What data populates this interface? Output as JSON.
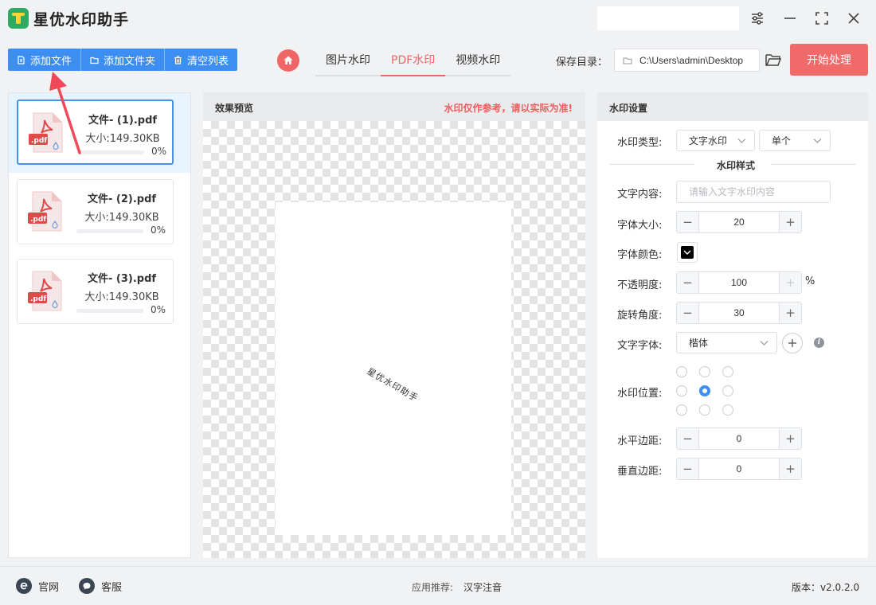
{
  "app": {
    "title": "星优水印助手"
  },
  "toolbar": {
    "add_file": "添加文件",
    "add_folder": "添加文件夹",
    "clear_list": "清空列表"
  },
  "tabs": [
    {
      "label": "图片水印",
      "active": false
    },
    {
      "label": "PDF水印",
      "active": true
    },
    {
      "label": "视频水印",
      "active": false
    }
  ],
  "save": {
    "label": "保存目录：",
    "path": "C:\\Users\\admin\\Desktop"
  },
  "start_button": "开始处理",
  "files": [
    {
      "name": "文件- (1).pdf",
      "size": "大小:149.30KB",
      "progress": "0%",
      "progress_value": 0,
      "selected": true
    },
    {
      "name": "文件- (2).pdf",
      "size": "大小:149.30KB",
      "progress": "0%",
      "progress_value": 0,
      "selected": false
    },
    {
      "name": "文件- (3).pdf",
      "size": "大小:149.30KB",
      "progress": "0%",
      "progress_value": 0,
      "selected": false
    }
  ],
  "preview": {
    "title": "效果预览",
    "note": "水印仅作参考，请以实际为准!",
    "watermark_text": "星优水印助手"
  },
  "settings": {
    "title": "水印设置",
    "type_label": "水印类型:",
    "type_value": "文字水印",
    "mode_value": "单个",
    "section_title": "水印样式",
    "text_label": "文字内容:",
    "text_placeholder": "请输入文字水印内容",
    "size_label": "字体大小:",
    "size_value": "20",
    "color_label": "字体颜色:",
    "color_value": "#000000",
    "opacity_label": "不透明度:",
    "opacity_value": "100",
    "opacity_unit": "%",
    "rotate_label": "旋转角度:",
    "rotate_value": "30",
    "font_label": "文字字体:",
    "font_value": "楷体",
    "position_label": "水印位置:",
    "position_selected": "center",
    "hmargin_label": "水平边距:",
    "hmargin_value": "0",
    "vmargin_label": "垂直边距:",
    "vmargin_value": "0"
  },
  "footer": {
    "website": "官网",
    "service": "客服",
    "recommend_label": "应用推荐:",
    "recommend_app": "汉字注音",
    "version": "版本：v2.0.2.0"
  },
  "colors": {
    "primary_blue": "#3d8ef0",
    "accent_red": "#f06565",
    "start_button": "#f06a6a"
  }
}
